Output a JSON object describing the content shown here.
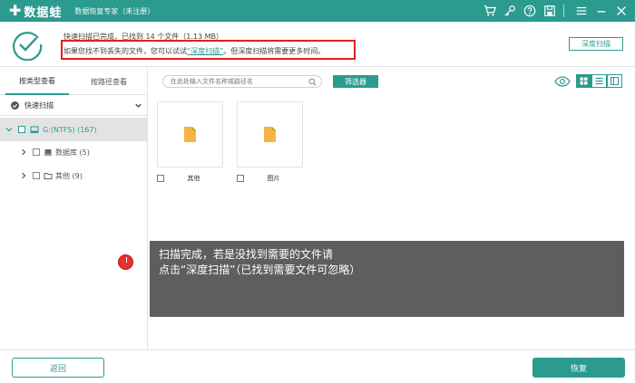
{
  "app": {
    "logo_text": "数据蛙",
    "subtitle": "数据恢复专家（未注册）"
  },
  "status": {
    "line1": "快速扫描已完成，已找到 14 个文件（1.13 MB）",
    "line2_prefix": "如果您找不到丢失的文件，您可以试试",
    "line2_link": "“深度扫描”",
    "line2_suffix": "。但深度扫描将需要更多时间。",
    "deep_scan_button": "深度扫描"
  },
  "left_panel": {
    "tabs": [
      "按类型查看",
      "按路径查看"
    ],
    "quick_scan": "快速扫描",
    "drive": "G:(NTFS) (167)",
    "tree_items": [
      "数据库 (5)",
      "其他 (9)"
    ]
  },
  "right_panel": {
    "search_placeholder": "在此处输入文件名称或路径名",
    "filter_button": "筛选器",
    "files": [
      {
        "label": "其他"
      },
      {
        "label": "图片"
      }
    ]
  },
  "tooltip": {
    "line1": "扫描完成，若是没找到需要的文件请",
    "line2": "点击“深度扫描”（已找到需要文件可忽略）"
  },
  "footer": {
    "back_button": "返回",
    "recover_button": "恢复"
  },
  "colors": {
    "accent": "#2b9b8f",
    "highlight": "#e02020",
    "tooltip_bg": "#555555",
    "marker": "#e23131"
  }
}
